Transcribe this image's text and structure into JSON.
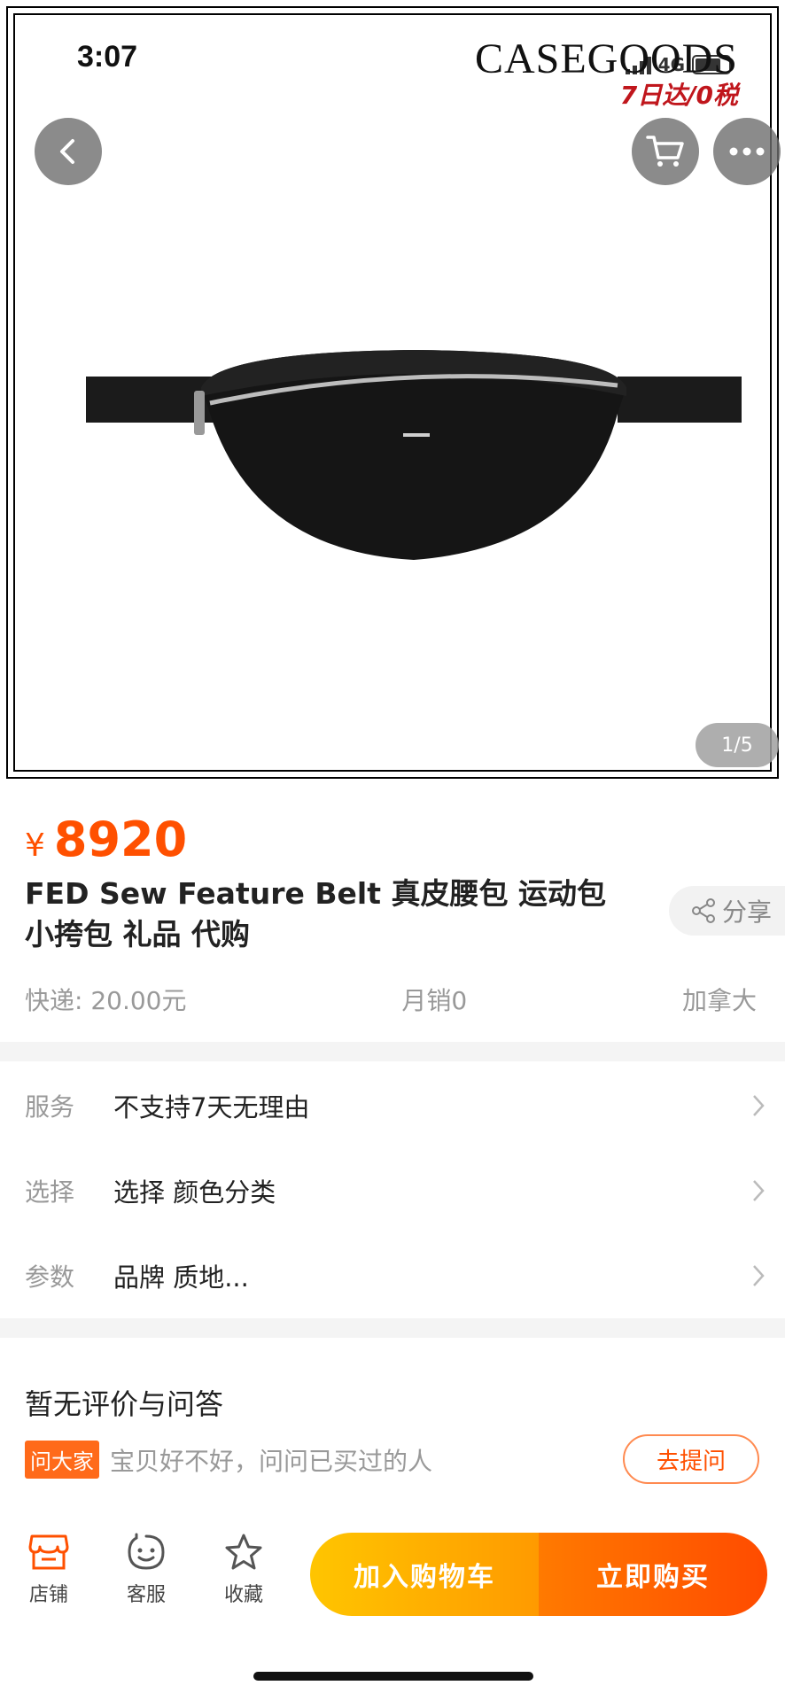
{
  "status": {
    "time": "3:07",
    "network": "4G"
  },
  "brand": {
    "name": "CASEGOODS",
    "tagline": "7日达/0税"
  },
  "hero": {
    "page_indicator": "1/5"
  },
  "product": {
    "currency": "¥",
    "price": "8920",
    "title": "FED Sew Feature Belt 真皮腰包 运动包 小挎包 礼品 代购",
    "share_label": "分享",
    "shipping": "快递: 20.00元",
    "monthly_sales": "月销0",
    "origin": "加拿大"
  },
  "info_rows": [
    {
      "key": "服务",
      "value": "不支持7天无理由"
    },
    {
      "key": "选择",
      "value": "选择  颜色分类"
    },
    {
      "key": "参数",
      "value": "品牌 质地..."
    }
  ],
  "qa": {
    "title": "暂无评价与问答",
    "tag": "问大家",
    "prompt": "宝贝好不好，问问已买过的人",
    "ask_button": "去提问"
  },
  "bottom_bar": {
    "shop": "店铺",
    "service": "客服",
    "favorite": "收藏",
    "add_to_cart": "加入购物车",
    "buy_now": "立即购买"
  },
  "colors": {
    "accent": "#ff5000",
    "cart_gradient": [
      "#ffc500",
      "#ff9a00"
    ],
    "buy_gradient": [
      "#ff7a00",
      "#ff4b00"
    ]
  }
}
